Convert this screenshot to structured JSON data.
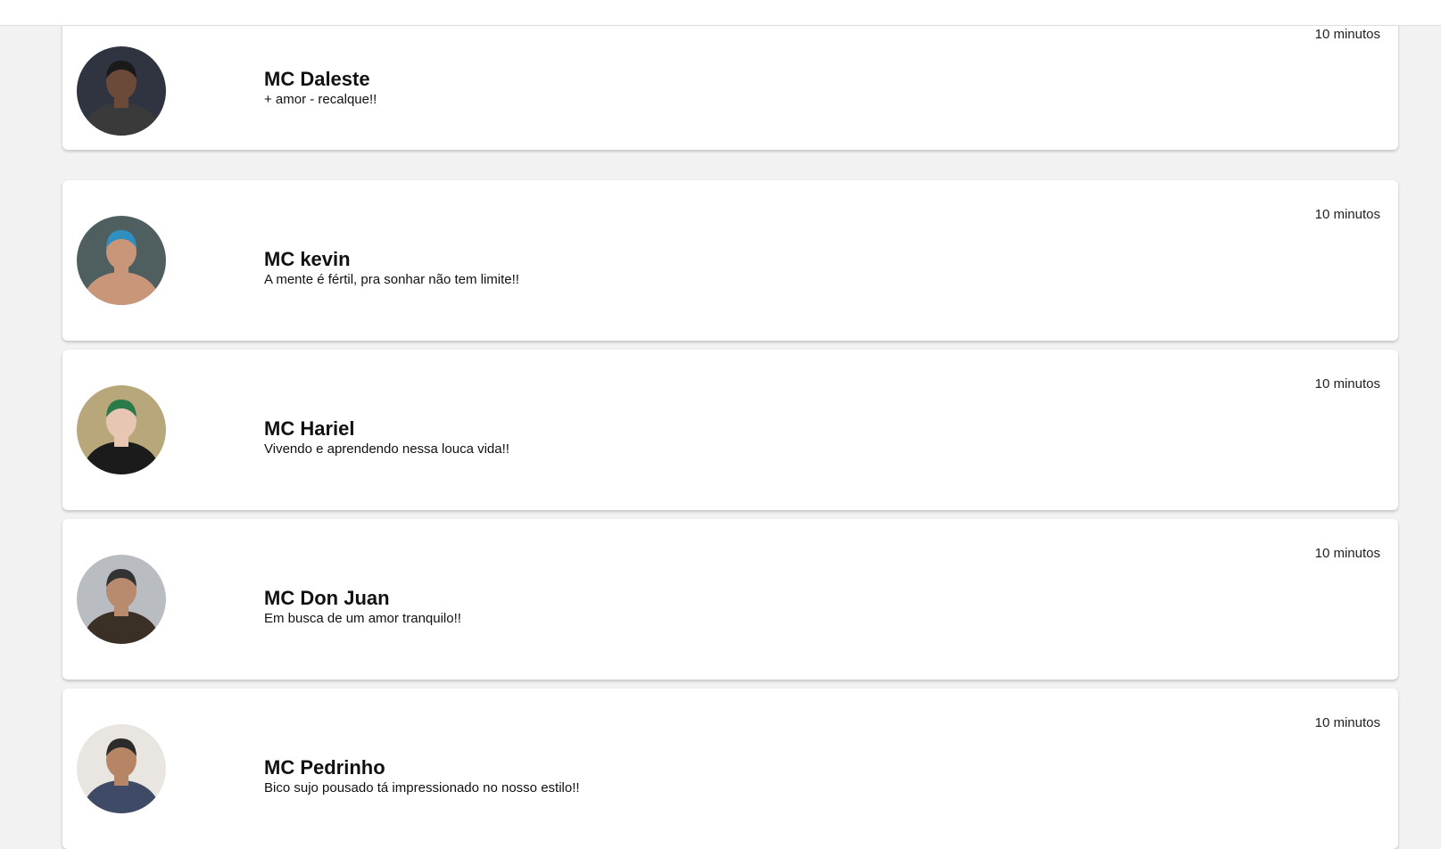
{
  "contacts": [
    {
      "name": "MC Daleste",
      "status": "+ amor - recalque!!",
      "time": "10 minutos",
      "avatar": {
        "bg": "#2f3440",
        "skin": "#6b4a3a",
        "hair": "#1a1a1a",
        "shirt": "#3a3a3a"
      }
    },
    {
      "name": "MC kevin",
      "status": "A mente é fértil, pra sonhar não tem limite!!",
      "time": "10 minutos",
      "avatar": {
        "bg": "#4f5f60",
        "skin": "#c9967a",
        "hair": "#2f8fc0",
        "shirt": "#c9967a"
      }
    },
    {
      "name": "MC Hariel",
      "status": "Vivendo e aprendendo nessa louca vida!!",
      "time": "10 minutos",
      "avatar": {
        "bg": "#b8a77a",
        "skin": "#e7c6b4",
        "hair": "#2a7a4a",
        "shirt": "#1b1b1b"
      }
    },
    {
      "name": "MC Don Juan",
      "status": "Em busca de um amor tranquilo!!",
      "time": "10 minutos",
      "avatar": {
        "bg": "#b9bcc0",
        "skin": "#b88a6e",
        "hair": "#333333",
        "shirt": "#3b3026"
      }
    },
    {
      "name": "MC Pedrinho",
      "status": "Bico sujo pousado tá impressionado no nosso estilo!!",
      "time": "10 minutos",
      "avatar": {
        "bg": "#e9e6e2",
        "skin": "#b58566",
        "hair": "#2b2b2b",
        "shirt": "#3f4a66"
      }
    }
  ]
}
